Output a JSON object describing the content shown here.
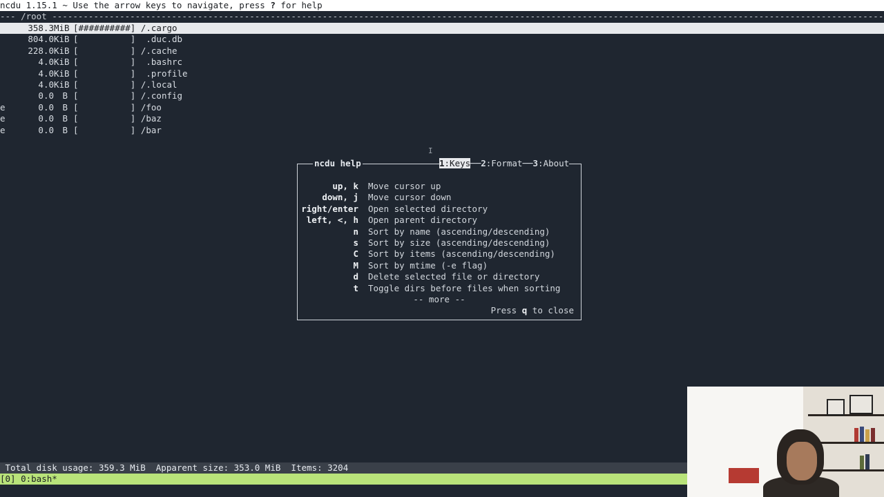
{
  "header": {
    "app_version": "ncdu 1.15.1",
    "hint_prefix": " ~ Use the arrow keys to navigate, press ",
    "hint_key": "?",
    "hint_suffix": " for help"
  },
  "path_line": "--- /root ---------------------------------------------------------------------------------------------------------------------------------------------------------------------------------------",
  "entries": [
    {
      "flag": "",
      "size": "358.3",
      "unit": "MiB",
      "bar": "[##########]",
      "name": "/.cargo",
      "selected": true
    },
    {
      "flag": "",
      "size": "804.0",
      "unit": "KiB",
      "bar": "[          ]",
      "name": " .duc.db",
      "selected": false
    },
    {
      "flag": "",
      "size": "228.0",
      "unit": "KiB",
      "bar": "[          ]",
      "name": "/.cache",
      "selected": false
    },
    {
      "flag": "",
      "size": "4.0",
      "unit": "KiB",
      "bar": "[          ]",
      "name": " .bashrc",
      "selected": false
    },
    {
      "flag": "",
      "size": "4.0",
      "unit": "KiB",
      "bar": "[          ]",
      "name": " .profile",
      "selected": false
    },
    {
      "flag": "",
      "size": "4.0",
      "unit": "KiB",
      "bar": "[          ]",
      "name": "/.local",
      "selected": false
    },
    {
      "flag": "",
      "size": "0.0",
      "unit": "B",
      "bar": "[          ]",
      "name": "/.config",
      "selected": false
    },
    {
      "flag": "e",
      "size": "0.0",
      "unit": "B",
      "bar": "[          ]",
      "name": "/foo",
      "selected": false
    },
    {
      "flag": "e",
      "size": "0.0",
      "unit": "B",
      "bar": "[          ]",
      "name": "/baz",
      "selected": false
    },
    {
      "flag": "e",
      "size": "0.0",
      "unit": "B",
      "bar": "[          ]",
      "name": "/bar",
      "selected": false
    }
  ],
  "help_dialog": {
    "title": "ncdu help",
    "tabs": [
      {
        "num": "1",
        "label": ":Keys",
        "active": true
      },
      {
        "num": "2",
        "label": ":Format",
        "active": false
      },
      {
        "num": "3",
        "label": ":About",
        "active": false
      }
    ],
    "rows": [
      {
        "key": "up, k",
        "desc": "Move cursor up"
      },
      {
        "key": "down, j",
        "desc": "Move cursor down"
      },
      {
        "key": "right/enter",
        "desc": "Open selected directory"
      },
      {
        "key": "left, <, h",
        "desc": "Open parent directory"
      },
      {
        "key": "n",
        "desc": "Sort by name (ascending/descending)"
      },
      {
        "key": "s",
        "desc": "Sort by size (ascending/descending)"
      },
      {
        "key": "C",
        "desc": "Sort by items (ascending/descending)"
      },
      {
        "key": "M",
        "desc": "Sort by mtime (-e flag)"
      },
      {
        "key": "d",
        "desc": "Delete selected file or directory"
      },
      {
        "key": "t",
        "desc": "Toggle dirs before files when sorting"
      }
    ],
    "more": "-- more --",
    "close_prefix": "Press ",
    "close_key": "q",
    "close_suffix": " to close"
  },
  "status": {
    "total_disk_usage": " Total disk usage: 359.3 MiB  Apparent size: 353.0 MiB  Items: 3204"
  },
  "tmux": {
    "window": "[0] 0:bash*"
  },
  "colors": {
    "background": "#1f2630",
    "selection": "#e7e9ec",
    "tmux_status": "#b9e37a"
  }
}
